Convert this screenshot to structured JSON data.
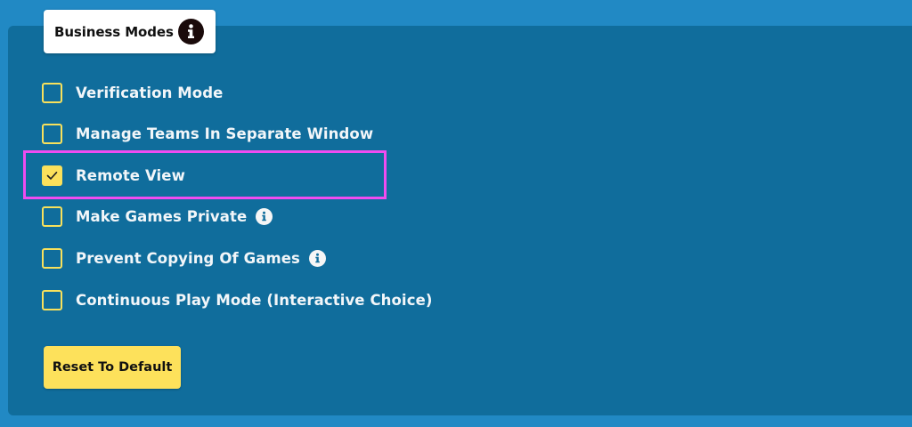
{
  "header": {
    "title": "Business Modes",
    "info_icon": "info-icon"
  },
  "options": [
    {
      "label": "Verification Mode",
      "checked": false,
      "has_info": false
    },
    {
      "label": "Manage Teams In Separate Window",
      "checked": false,
      "has_info": false
    },
    {
      "label": "Remote View",
      "checked": true,
      "has_info": false,
      "highlighted": true
    },
    {
      "label": "Make Games Private",
      "checked": false,
      "has_info": true
    },
    {
      "label": "Prevent Copying Of Games",
      "checked": false,
      "has_info": true
    },
    {
      "label": "Continuous Play Mode (Interactive Choice)",
      "checked": false,
      "has_info": false
    }
  ],
  "reset_button": {
    "label": "Reset To Default"
  },
  "colors": {
    "background": "#2189c4",
    "panel": "#106d9c",
    "accent_yellow": "#fde15b",
    "highlight_magenta": "#f04cf0"
  }
}
